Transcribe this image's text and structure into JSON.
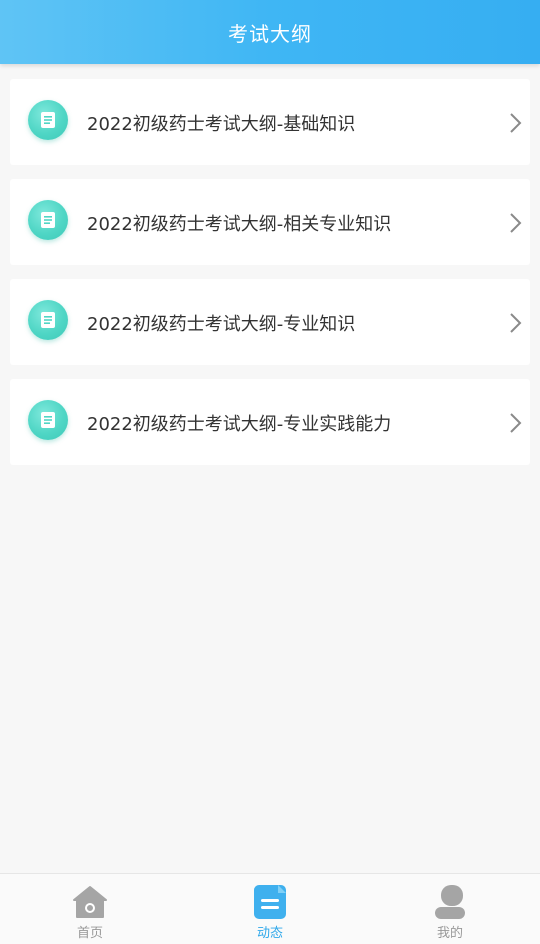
{
  "header": {
    "title": "考试大纲"
  },
  "items": [
    {
      "label": "2022初级药士考试大纲-基础知识",
      "icon": "document-icon"
    },
    {
      "label": "2022初级药士考试大纲-相关专业知识",
      "icon": "document-icon"
    },
    {
      "label": "2022初级药士考试大纲-专业知识",
      "icon": "document-icon"
    },
    {
      "label": "2022初级药士考试大纲-专业实践能力",
      "icon": "document-icon"
    }
  ],
  "tabbar": {
    "tabs": [
      {
        "label": "首页",
        "icon": "home-icon",
        "active": false
      },
      {
        "label": "动态",
        "icon": "news-icon",
        "active": true
      },
      {
        "label": "我的",
        "icon": "profile-icon",
        "active": false
      }
    ]
  },
  "colors": {
    "header_gradient_start": "#5fc4f5",
    "header_gradient_end": "#36aef2",
    "badge": "#4fd6c5",
    "active_tab": "#2fa8ea",
    "inactive_tab": "#999999"
  }
}
